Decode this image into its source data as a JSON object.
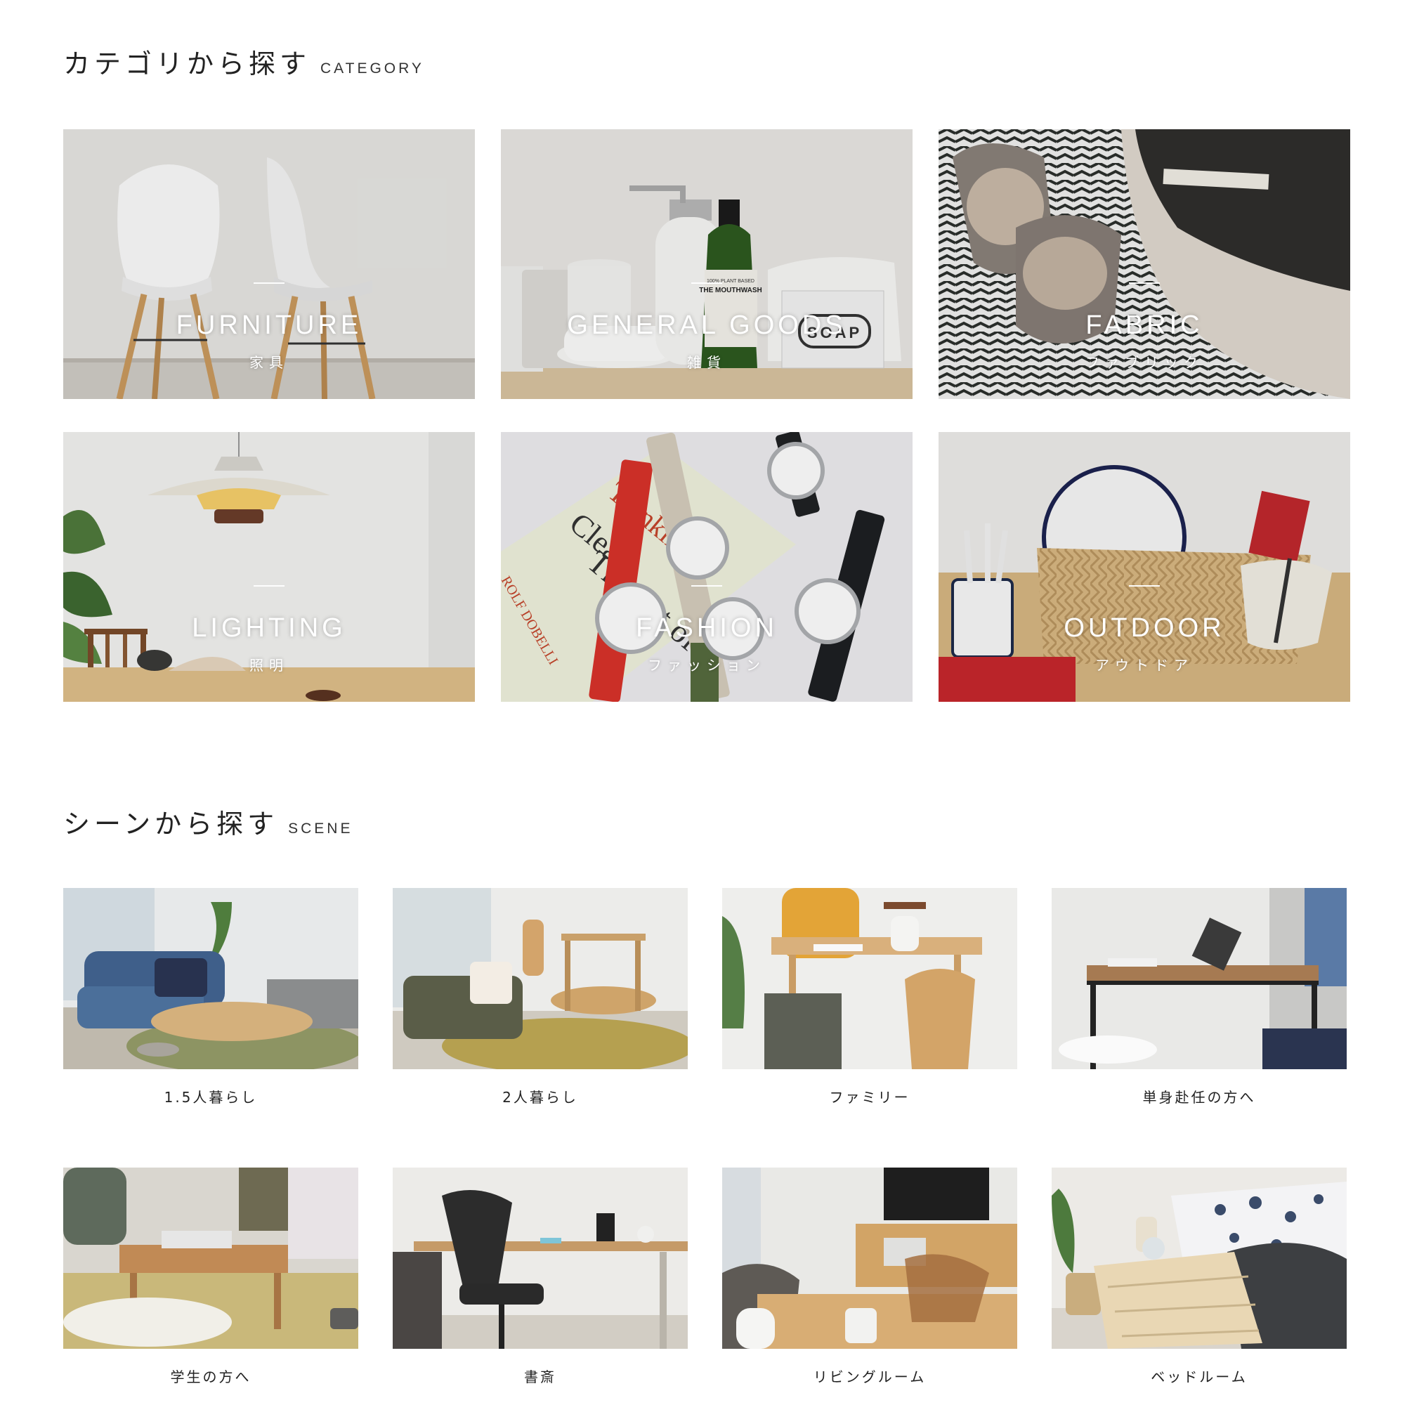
{
  "category_section": {
    "title_jp": "カテゴリから探す",
    "title_en": "CATEGORY",
    "items": [
      {
        "en": "FURNITURE",
        "jp": "家具"
      },
      {
        "en": "GENERAL GOODS",
        "jp": "雑貨"
      },
      {
        "en": "FABRIC",
        "jp": "ファブリック"
      },
      {
        "en": "LIGHTING",
        "jp": "照明"
      },
      {
        "en": "FASHION",
        "jp": "ファッション"
      },
      {
        "en": "OUTDOOR",
        "jp": "アウトドア"
      }
    ]
  },
  "scene_section": {
    "title_jp": "シーンから探す",
    "title_en": "SCENE",
    "items": [
      {
        "label": "1.5人暮らし"
      },
      {
        "label": "2人暮らし"
      },
      {
        "label": "ファミリー"
      },
      {
        "label": "単身赴任の方へ"
      },
      {
        "label": "学生の方へ"
      },
      {
        "label": "書斎"
      },
      {
        "label": "リビングルーム"
      },
      {
        "label": "ベッドルーム"
      }
    ]
  },
  "photo_text": {
    "mouthwash_top": "100% PLANT BASED",
    "mouthwash": "THE MOUTHWASH",
    "soap": "SOAP",
    "book_a": "The Art of",
    "book_b": "Clear",
    "book_c": "Thinking",
    "book_author": "ROLF DOBELLI"
  }
}
